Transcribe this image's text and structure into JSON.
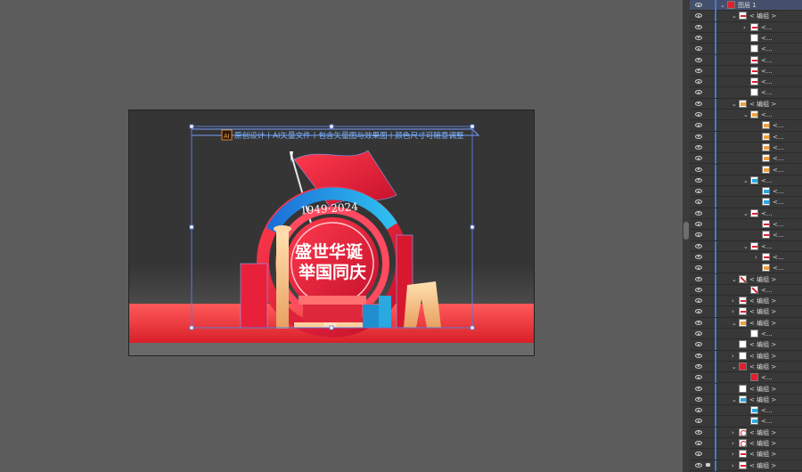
{
  "artboard": {
    "header_text": "原创设计丨AI矢量文件丨包含矢量图与效果图丨颜色尺寸可随意调整",
    "badge_label": "AI",
    "year_text": "1949·2024",
    "title_line1": "盛世华诞",
    "title_line2": "举国同庆",
    "small_text": "庆国庆"
  },
  "colors": {
    "canvas": "#5c5c5c",
    "artboard": "#353535",
    "red": "#e8203a",
    "blue": "#2aa8e0",
    "selection": "#5b7bd8"
  },
  "layers": {
    "top_layer_name": "图层 1",
    "group_label": "< 编组 >",
    "path_label": "<...",
    "rows": [
      {
        "label": "图层 1",
        "chev": true,
        "expanded": true,
        "indent": 0,
        "thumb": "red",
        "selected": true
      },
      {
        "label": "< 编组 >",
        "chev": true,
        "expanded": true,
        "indent": 1,
        "thumb": "mk"
      },
      {
        "label": "<...",
        "chev": true,
        "expanded": false,
        "indent": 2,
        "thumb": "mk"
      },
      {
        "label": "<...",
        "chev": false,
        "indent": 2,
        "thumb": "plain"
      },
      {
        "label": "<...",
        "chev": false,
        "indent": 2,
        "thumb": "plain"
      },
      {
        "label": "<...",
        "chev": false,
        "indent": 2,
        "thumb": "mk"
      },
      {
        "label": "<...",
        "chev": false,
        "indent": 2,
        "thumb": "mk"
      },
      {
        "label": "<...",
        "chev": false,
        "indent": 2,
        "thumb": "mk"
      },
      {
        "label": "<...",
        "chev": false,
        "indent": 2,
        "thumb": "plain"
      },
      {
        "label": "< 编组 >",
        "chev": true,
        "expanded": true,
        "indent": 1,
        "thumb": "orange"
      },
      {
        "label": "<...",
        "chev": true,
        "expanded": true,
        "indent": 2,
        "thumb": "orange"
      },
      {
        "label": "<...",
        "chev": false,
        "indent": 3,
        "thumb": "orange"
      },
      {
        "label": "<...",
        "chev": false,
        "indent": 3,
        "thumb": "orange"
      },
      {
        "label": "<...",
        "chev": false,
        "indent": 3,
        "thumb": "orange"
      },
      {
        "label": "<...",
        "chev": false,
        "indent": 3,
        "thumb": "orange"
      },
      {
        "label": "<...",
        "chev": false,
        "indent": 3,
        "thumb": "orange"
      },
      {
        "label": "<...",
        "chev": true,
        "expanded": true,
        "indent": 2,
        "thumb": "blue"
      },
      {
        "label": "<...",
        "chev": false,
        "indent": 3,
        "thumb": "blue"
      },
      {
        "label": "<...",
        "chev": false,
        "indent": 3,
        "thumb": "blue"
      },
      {
        "label": "<...",
        "chev": true,
        "expanded": true,
        "indent": 2,
        "thumb": "mk"
      },
      {
        "label": "<...",
        "chev": false,
        "indent": 3,
        "thumb": "mk"
      },
      {
        "label": "<...",
        "chev": false,
        "indent": 3,
        "thumb": "mk"
      },
      {
        "label": "<...",
        "chev": true,
        "expanded": true,
        "indent": 2,
        "thumb": "mk"
      },
      {
        "label": "<...",
        "chev": true,
        "expanded": false,
        "indent": 3,
        "thumb": "mk"
      },
      {
        "label": "<...",
        "chev": false,
        "indent": 3,
        "thumb": "orange"
      },
      {
        "label": "< 编组 >",
        "chev": true,
        "expanded": true,
        "indent": 1,
        "thumb": "diag"
      },
      {
        "label": "<...",
        "chev": false,
        "indent": 2,
        "thumb": "diag"
      },
      {
        "label": "< 编组 >",
        "chev": true,
        "expanded": false,
        "indent": 1,
        "thumb": "mk"
      },
      {
        "label": "< 编组 >",
        "chev": true,
        "expanded": false,
        "indent": 1,
        "thumb": "mk"
      },
      {
        "label": "< 编组 >",
        "chev": true,
        "expanded": true,
        "indent": 1,
        "thumb": "orange"
      },
      {
        "label": "<...",
        "chev": false,
        "indent": 2,
        "thumb": "plain"
      },
      {
        "label": "< 编组 >",
        "chev": false,
        "indent": 1,
        "thumb": "plain"
      },
      {
        "label": "< 编组 >",
        "chev": true,
        "expanded": false,
        "indent": 1,
        "thumb": "plain"
      },
      {
        "label": "< 编组 >",
        "chev": true,
        "expanded": true,
        "indent": 1,
        "thumb": "red"
      },
      {
        "label": "<...",
        "chev": false,
        "indent": 2,
        "thumb": "red"
      },
      {
        "label": "< 编组 >",
        "chev": false,
        "indent": 1,
        "thumb": "plain"
      },
      {
        "label": "< 编组 >",
        "chev": true,
        "expanded": true,
        "indent": 1,
        "thumb": "blue"
      },
      {
        "label": "<...",
        "chev": false,
        "indent": 2,
        "thumb": "blue"
      },
      {
        "label": "<...",
        "chev": false,
        "indent": 2,
        "thumb": "blue"
      },
      {
        "label": "< 编组 >",
        "chev": true,
        "expanded": false,
        "indent": 1,
        "thumb": "redring"
      },
      {
        "label": "< 编组 >",
        "chev": true,
        "expanded": false,
        "indent": 1,
        "thumb": "redring"
      },
      {
        "label": "< 编组 >",
        "chev": true,
        "expanded": false,
        "indent": 1,
        "thumb": "mk"
      },
      {
        "label": "< 编组 >",
        "chev": true,
        "expanded": false,
        "indent": 1,
        "thumb": "mk",
        "locked": true
      }
    ]
  }
}
